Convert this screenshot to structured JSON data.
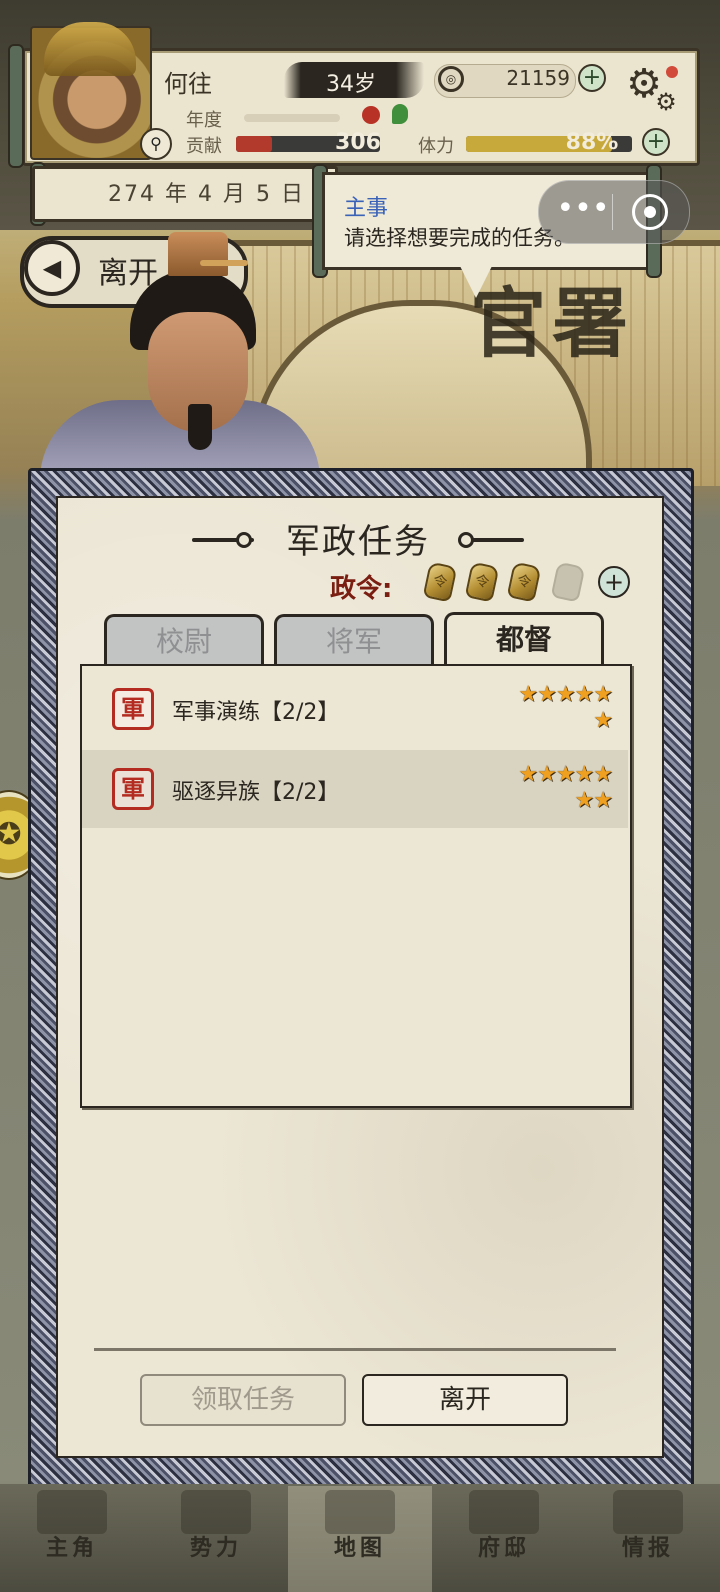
{
  "player": {
    "name": "何往",
    "age": "34岁",
    "coins": "21159",
    "year_label": "年度",
    "contribution_label": "贡献",
    "contribution_value": "306",
    "contribution_fraction": 0.25,
    "stamina_label": "体力",
    "stamina_value": "88%",
    "stamina_fraction": 0.88
  },
  "date": "274 年 4 月 5 日",
  "top_leave": {
    "label": "离开"
  },
  "speech": {
    "speaker": "主事",
    "text": "请选择想要完成的任务。"
  },
  "building_sign": "官署",
  "dialog": {
    "title": "军政任务",
    "decree_label": "政令:",
    "decree_tokens_filled": 3,
    "decree_tokens_total": 4,
    "token_glyph": "令",
    "tabs": [
      {
        "label": "校尉",
        "active": false
      },
      {
        "label": "将军",
        "active": false
      },
      {
        "label": "都督",
        "active": true
      }
    ],
    "tasks": [
      {
        "seal": "軍",
        "label": "军事演练【2/2】",
        "stars": 6
      },
      {
        "seal": "軍",
        "label": "驱逐异族【2/2】",
        "stars": 7
      }
    ],
    "buttons": {
      "accept": "领取任务",
      "leave": "离开"
    }
  },
  "bottom_nav": [
    {
      "label": "主角"
    },
    {
      "label": "势力"
    },
    {
      "label": "地图"
    },
    {
      "label": "府邸"
    },
    {
      "label": "情报"
    }
  ],
  "icons": {
    "coin": "coin-icon",
    "settings": "gear-icon",
    "add": "plus-icon",
    "search": "search-icon",
    "back": "back-arrow-icon",
    "star": "star-icon",
    "seal": "army-seal-icon"
  },
  "colors": {
    "accent_red": "#b32b21",
    "star_gold": "#f0a020",
    "speaker_blue": "#3a63b8",
    "paper": "#ece6d5"
  }
}
